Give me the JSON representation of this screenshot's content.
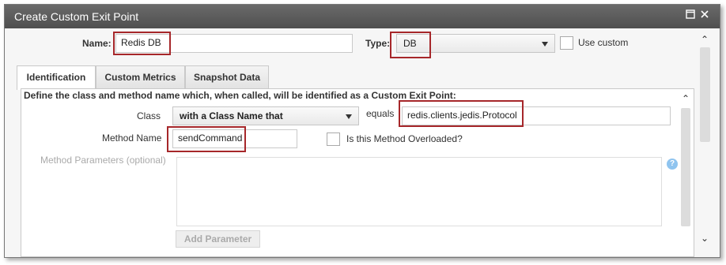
{
  "dialog": {
    "title": "Create Custom Exit Point",
    "icons": {
      "restore": "restore-icon",
      "close": "close-icon"
    }
  },
  "form": {
    "name_label": "Name:",
    "name_value": "Redis DB",
    "type_label": "Type:",
    "type_value": "DB",
    "use_custom_label": "Use custom"
  },
  "tabs": [
    {
      "label": "Identification",
      "active": true
    },
    {
      "label": "Custom Metrics",
      "active": false
    },
    {
      "label": "Snapshot Data",
      "active": false
    }
  ],
  "identification": {
    "description": "Define the class and method name which, when called, will be identified as a Custom Exit Point:",
    "class_label": "Class",
    "class_match_value": "with a Class Name that",
    "equals_label": "equals",
    "class_name_value": "redis.clients.jedis.Protocol",
    "method_name_label": "Method Name",
    "method_name_value": "sendCommand",
    "overloaded_label": "Is this Method Overloaded?",
    "method_params_label": "Method Parameters (optional)",
    "help_glyph": "?",
    "add_parameter_label": "Add Parameter"
  },
  "highlight_color": "#a6272a",
  "titlebar_color": "#555555"
}
